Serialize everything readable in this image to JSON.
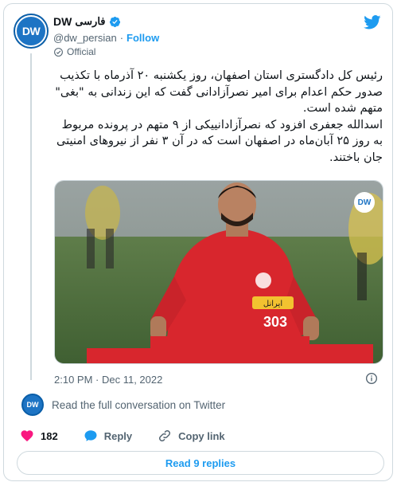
{
  "account": {
    "name_latin": "DW",
    "name_farsi": "فارسی",
    "handle": "@dw_persian",
    "separator": "·",
    "follow_label": "Follow",
    "official_label": "Official",
    "avatar_text": "DW"
  },
  "tweet": {
    "paragraph1": "رئیس کل دادگستری استان اصفهان، روز یکشنبه ۲۰ آذرماه با تکذیب صدور حکم اعدام برای امیر نصرآزادانی گفت که این زندانی به \"بغی\" متهم شده است.",
    "paragraph2": "اسدالله جعفری افزود که نصرآزادانییکی از ۹ متهم در پرونده مربوط به روز ۲۵ آبان‌ماه در اصفهان است که در آن ۳ نفر از نیروهای امنیتی جان باختند.",
    "media_badge": "DW",
    "jersey_sponsor": "ایرانل",
    "jersey_number": "303",
    "timestamp": "2:10 PM · Dec 11, 2022"
  },
  "conversation": {
    "avatar_text": "DW",
    "link_label": "Read the full conversation on Twitter"
  },
  "actions": {
    "like_count": "182",
    "reply_label": "Reply",
    "copy_link_label": "Copy link",
    "read_replies_label": "Read 9 replies"
  },
  "icons": {
    "verified": "verified-badge-icon",
    "official": "official-seal-icon",
    "twitter": "twitter-bird-icon",
    "info": "info-icon",
    "like": "heart-icon",
    "reply": "reply-bubble-icon",
    "copy_link": "link-icon"
  },
  "colors": {
    "accent": "#1d9bf0",
    "heart": "#f91880",
    "muted": "#536471",
    "border": "#cfd9de",
    "dw_blue": "#1d74c4",
    "jersey_red": "#d8262d"
  }
}
